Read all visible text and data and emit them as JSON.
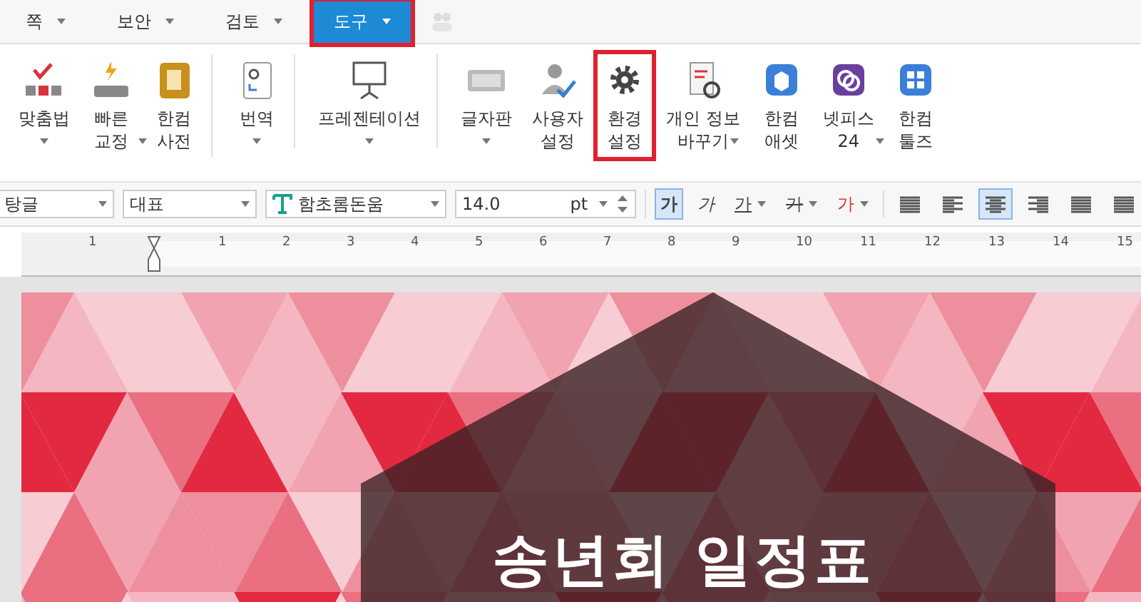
{
  "menu_tabs": [
    {
      "label": "쪽",
      "selected": false,
      "highlighted": false
    },
    {
      "label": "보안",
      "selected": false,
      "highlighted": false
    },
    {
      "label": "검토",
      "selected": false,
      "highlighted": false
    },
    {
      "label": "도구",
      "selected": true,
      "highlighted": true
    }
  ],
  "ribbon": [
    {
      "kind": "spell",
      "lines": [
        "맞춤법"
      ],
      "dropdown": true,
      "highlighted": false,
      "group_end": false
    },
    {
      "kind": "quick",
      "lines": [
        "빠른",
        "교정"
      ],
      "dropdown": true,
      "highlighted": false,
      "group_end": false
    },
    {
      "kind": "dict",
      "lines": [
        "한컴",
        "사전"
      ],
      "dropdown": false,
      "highlighted": false,
      "group_end": true
    },
    {
      "kind": "translate",
      "lines": [
        "번역"
      ],
      "dropdown": true,
      "highlighted": false,
      "group_end": true
    },
    {
      "kind": "present",
      "lines": [
        "프레젠테이션"
      ],
      "dropdown": true,
      "highlighted": false,
      "group_end": true
    },
    {
      "kind": "keyboard",
      "lines": [
        "글자판"
      ],
      "dropdown": true,
      "highlighted": false,
      "group_end": false
    },
    {
      "kind": "user",
      "lines": [
        "사용자",
        "설정"
      ],
      "dropdown": false,
      "highlighted": false,
      "group_end": false
    },
    {
      "kind": "gear",
      "lines": [
        "환경",
        "설정"
      ],
      "dropdown": false,
      "highlighted": true,
      "group_end": false
    },
    {
      "kind": "privacy",
      "lines": [
        "개인 정보",
        "바꾸기"
      ],
      "dropdown": true,
      "highlighted": false,
      "group_end": false
    },
    {
      "kind": "asset",
      "lines": [
        "한컴",
        "애셋"
      ],
      "dropdown": false,
      "highlighted": false,
      "group_end": false
    },
    {
      "kind": "netffice",
      "lines": [
        "넷피스",
        "24"
      ],
      "dropdown": true,
      "highlighted": false,
      "group_end": false
    },
    {
      "kind": "tools",
      "lines": [
        "한컴",
        "툴즈"
      ],
      "dropdown": false,
      "highlighted": false,
      "group_end": false
    }
  ],
  "format_bar": {
    "style": "탕글",
    "language": "대표",
    "font": "함초롬돈움",
    "size": "14.0",
    "unit": "pt",
    "char_buttons": [
      {
        "label": "가",
        "kind": "bold",
        "selected": true
      },
      {
        "label": "가",
        "kind": "italic",
        "selected": false
      },
      {
        "label": "가",
        "kind": "underline",
        "selected": false
      },
      {
        "label": "가",
        "kind": "strike",
        "selected": false
      },
      {
        "label": "가",
        "kind": "color",
        "selected": false
      }
    ],
    "align_buttons": [
      {
        "kind": "justify",
        "selected": false
      },
      {
        "kind": "left",
        "selected": false
      },
      {
        "kind": "center",
        "selected": true
      },
      {
        "kind": "right",
        "selected": false
      },
      {
        "kind": "distribute",
        "selected": false
      },
      {
        "kind": "divide",
        "selected": false
      }
    ]
  },
  "ruler": {
    "labels": [
      "1",
      "1",
      "2",
      "3",
      "4",
      "5",
      "6",
      "7",
      "8",
      "9",
      "10",
      "11",
      "12",
      "13",
      "14",
      "15"
    ]
  },
  "document": {
    "title": "송년회 일정표"
  }
}
